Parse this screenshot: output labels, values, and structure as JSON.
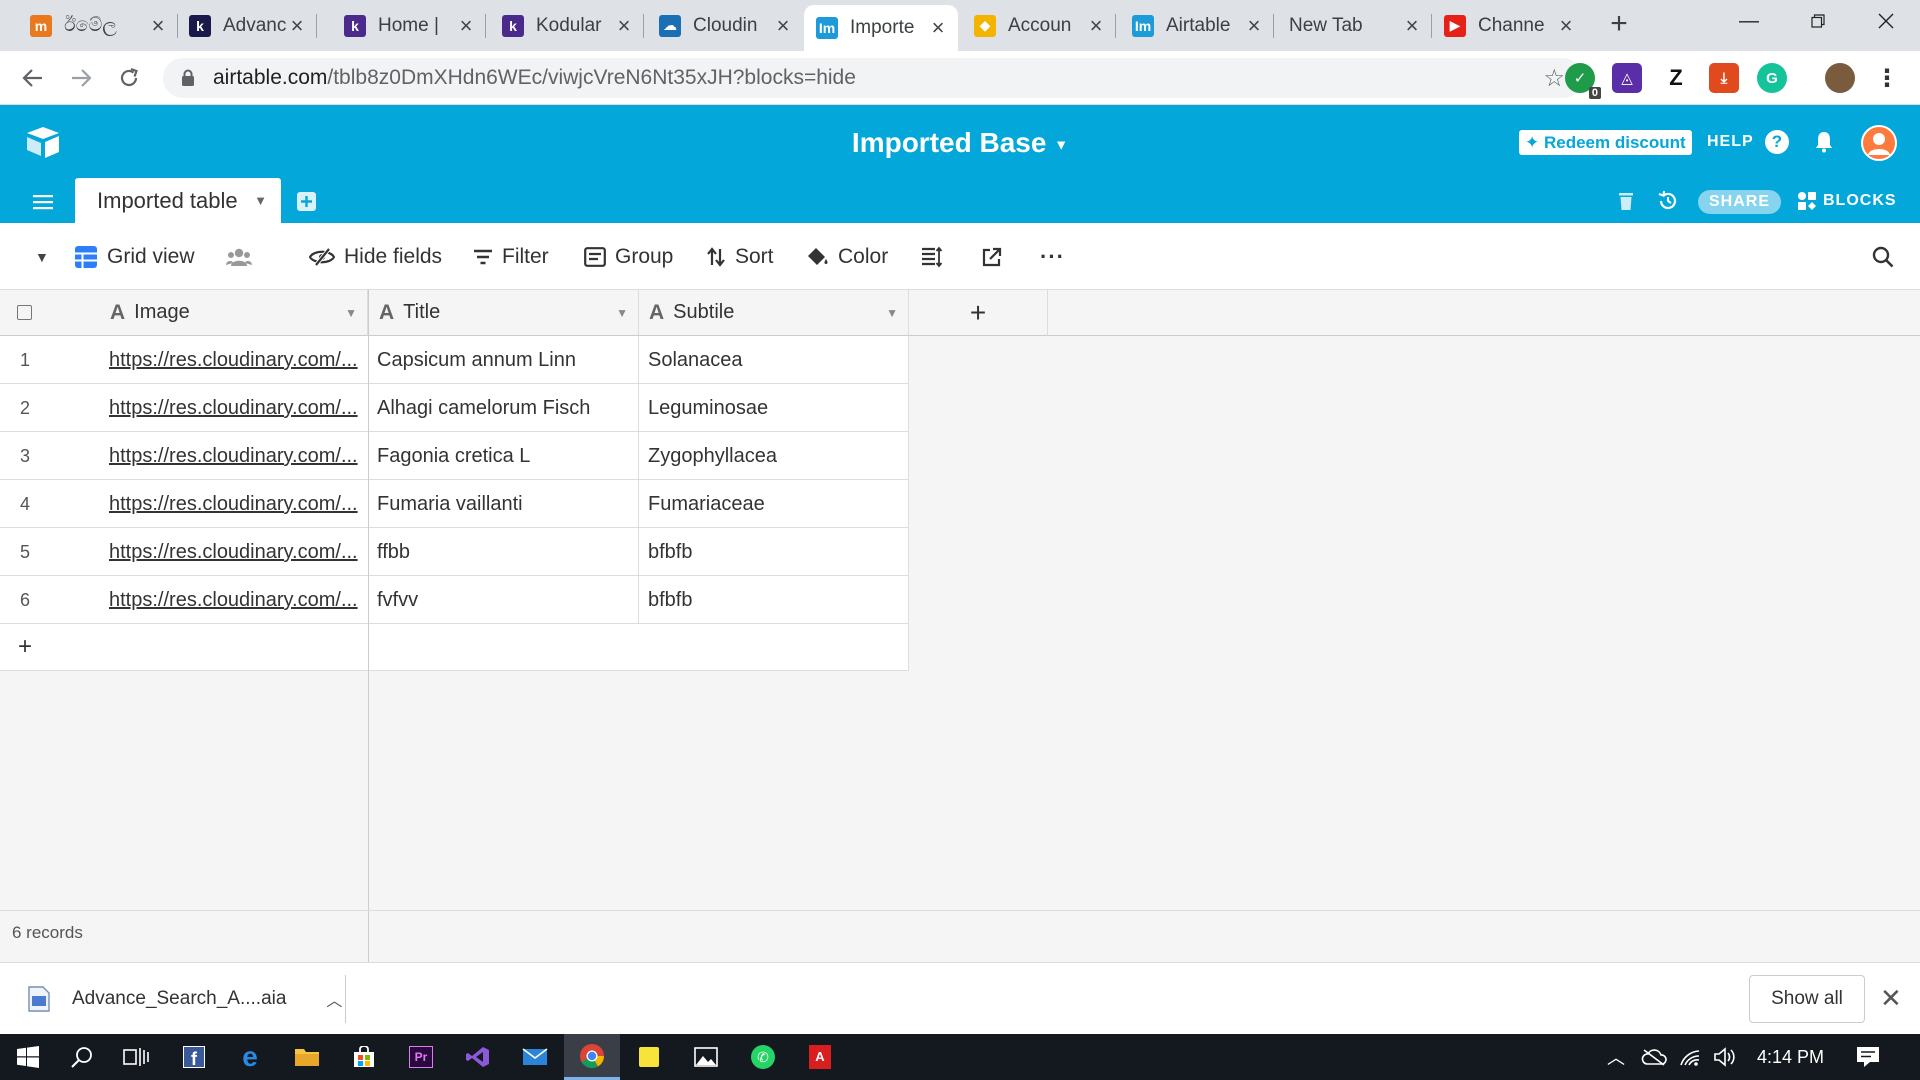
{
  "browser": {
    "tabs": [
      {
        "label": "ඊමේල",
        "fav": "m",
        "color": "#e8791f",
        "active": false
      },
      {
        "label": "Advanc",
        "fav": "k",
        "color": "#1a1a4a",
        "active": false
      },
      {
        "label": "Home |",
        "fav": "k",
        "color": "#4a2a8a",
        "active": false
      },
      {
        "label": "Kodular",
        "fav": "k",
        "color": "#4a2a8a",
        "active": false
      },
      {
        "label": "Cloudin",
        "fav": "☁",
        "color": "#1a6fb5",
        "active": false
      },
      {
        "label": "Importe",
        "fav": "Im",
        "color": "#1d9bd8",
        "active": true
      },
      {
        "label": "Accoun",
        "fav": "◆",
        "color": "#f2b400",
        "active": false
      },
      {
        "label": "Airtable",
        "fav": "Im",
        "color": "#1d9bd8",
        "active": false
      },
      {
        "label": "New Tab",
        "fav": "",
        "color": "",
        "active": false
      },
      {
        "label": "Channe",
        "fav": "▶",
        "color": "#e62117",
        "active": false
      }
    ],
    "new_tab": "+",
    "url_host": "airtable.com",
    "url_path": "/tblb8z0DmXHdn6WEc/viwjcVreN6Nt35xJH?blocks=hide",
    "ext_badge": "0"
  },
  "header": {
    "base_title": "Imported Base",
    "redeem": "Redeem discount",
    "help": "HELP",
    "table_tab": "Imported table",
    "share": "SHARE",
    "blocks": "BLOCKS"
  },
  "viewbar": {
    "view_name": "Grid view",
    "hide_fields": "Hide fields",
    "filter": "Filter",
    "group": "Group",
    "sort": "Sort",
    "color": "Color"
  },
  "grid": {
    "columns": [
      {
        "name": "Image",
        "type": "A"
      },
      {
        "name": "Title",
        "type": "A"
      },
      {
        "name": "Subtile",
        "type": "A"
      }
    ],
    "add_column": "+",
    "add_row": "+",
    "rows": [
      {
        "num": "1",
        "image": "https://res.cloudinary.com/...",
        "title": "Capsicum annum Linn",
        "subtile": "Solanacea"
      },
      {
        "num": "2",
        "image": "https://res.cloudinary.com/...",
        "title": "Alhagi camelorum Fisch",
        "subtile": "Leguminosae"
      },
      {
        "num": "3",
        "image": "https://res.cloudinary.com/...",
        "title": "Fagonia cretica L",
        "subtile": "Zygophyllacea"
      },
      {
        "num": "4",
        "image": "https://res.cloudinary.com/...",
        "title": "Fumaria vaillanti",
        "subtile": "Fumariaceae"
      },
      {
        "num": "5",
        "image": "https://res.cloudinary.com/...",
        "title": "ffbb",
        "subtile": "bfbfb"
      },
      {
        "num": "6",
        "image": "https://res.cloudinary.com/...",
        "title": "fvfvv",
        "subtile": "bfbfb"
      }
    ],
    "record_count": "6 records"
  },
  "download": {
    "file": "Advance_Search_A....aia",
    "show_all": "Show all"
  },
  "taskbar": {
    "time": "4:14 PM"
  },
  "colors": {
    "airtable_blue": "#04a7d9",
    "tab_strip": "#dee1e6"
  }
}
